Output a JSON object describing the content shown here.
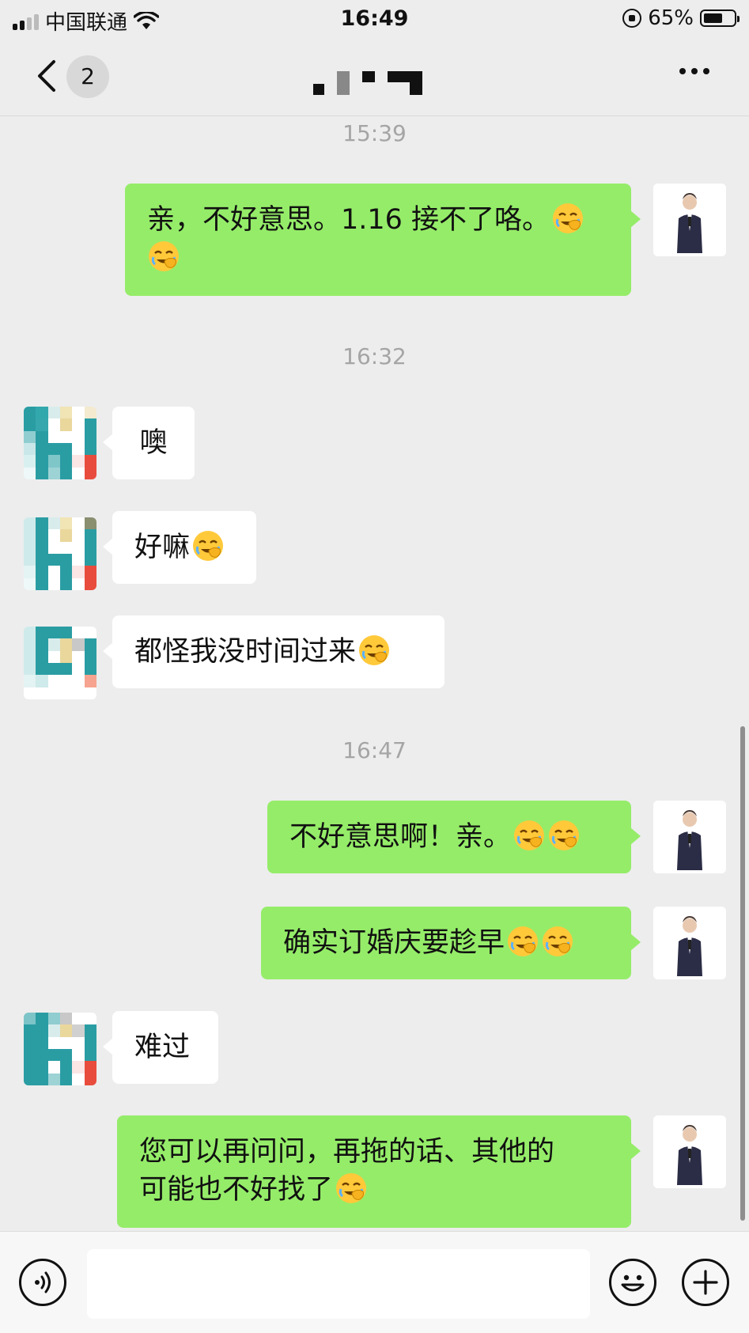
{
  "status_bar": {
    "carrier": "中国联通",
    "time": "16:49",
    "battery": "65%",
    "battery_level": 0.65
  },
  "nav": {
    "unread_badge": "2"
  },
  "chat": {
    "timestamps": [
      "15:39",
      "16:32",
      "16:47"
    ],
    "messages": [
      {
        "from": "me",
        "line1": "亲，不好意思。1.16 接不了咯。",
        "emoji_count": 2
      },
      {
        "from": "them",
        "text": "噢"
      },
      {
        "from": "them",
        "text": "好嘛",
        "emoji_count": 1
      },
      {
        "from": "them",
        "text": "都怪我没时间过来",
        "emoji_count": 1
      },
      {
        "from": "me",
        "text": "不好意思啊！亲。",
        "emoji_count": 2
      },
      {
        "from": "me",
        "text": "确实订婚庆要趁早",
        "emoji_count": 2
      },
      {
        "from": "them",
        "text": "难过"
      },
      {
        "from": "me",
        "line1": "您可以再问问，再拖的话、其他的",
        "line2": "可能也不好找了",
        "emoji_count": 1
      }
    ]
  },
  "input": {
    "placeholder": ""
  },
  "icons": {
    "back": "chevron-left-icon",
    "more": "more-dots-icon",
    "voice": "voice-icon",
    "emoji": "emoji-icon",
    "add": "plus-icon",
    "face_palm_emoji": "face-palm-laughing-emoji"
  },
  "colors": {
    "background": "#ededed",
    "bubble_me": "#95ec69",
    "bubble_them": "#ffffff",
    "timestamp": "#a5a5a5"
  }
}
